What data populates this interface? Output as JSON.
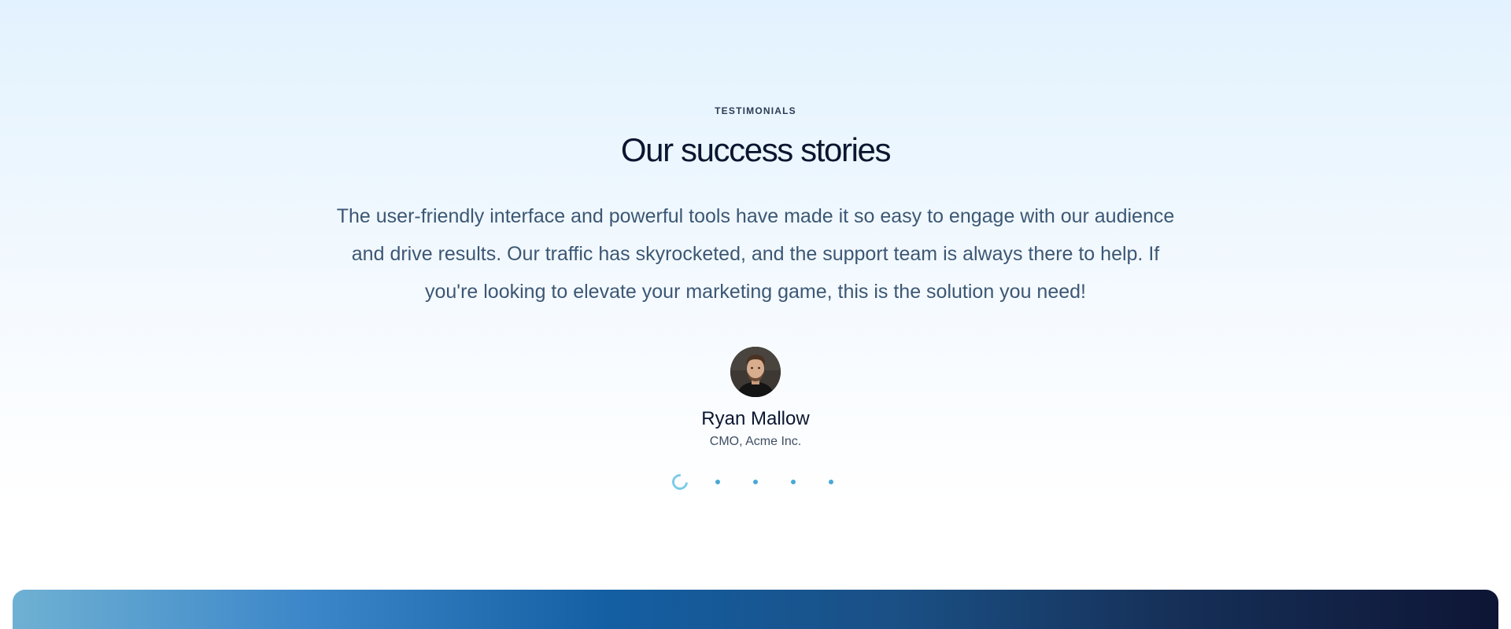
{
  "testimonials": {
    "eyebrow": "TESTIMONIALS",
    "title": "Our success stories",
    "quote": "The user-friendly interface and powerful tools have made it so easy to engage with our audience and drive results. Our traffic has skyrocketed, and the support team is always there to help. If you're looking to elevate your marketing game, this is the solution you need!",
    "author": {
      "name": "Ryan Mallow",
      "role": "CMO, Acme Inc."
    },
    "pagination": {
      "total": 5,
      "active_index": 0,
      "active_color": "#7ccbe9",
      "dot_color": "#4aa8d6"
    }
  },
  "colors": {
    "background_top": "#e2f2fe",
    "heading": "#0b1630",
    "body_text": "#3c5774",
    "banner_start": "#6fb1d3",
    "banner_end": "#0e1535"
  }
}
